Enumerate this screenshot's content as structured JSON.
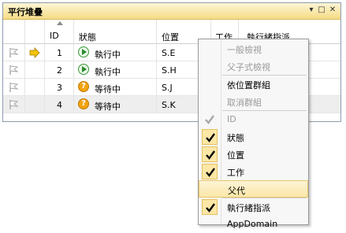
{
  "panel": {
    "title": "平行堆疊",
    "controls": {
      "dropdown": "▾",
      "maximize": "□",
      "close": "✕"
    }
  },
  "columns": [
    "",
    "",
    "ID",
    "狀態",
    "位置",
    "工作",
    "執行緒指派"
  ],
  "rows": [
    {
      "id": "1",
      "status": "執行中",
      "status_kind": "running",
      "location": "S.E",
      "current": true,
      "selected": false
    },
    {
      "id": "2",
      "status": "執行中",
      "status_kind": "running",
      "location": "S.H",
      "current": false,
      "selected": false
    },
    {
      "id": "3",
      "status": "等待中",
      "status_kind": "waiting",
      "location": "S.J",
      "current": false,
      "selected": false
    },
    {
      "id": "4",
      "status": "等待中",
      "status_kind": "waiting",
      "location": "S.K",
      "current": false,
      "selected": true
    }
  ],
  "status_icons": {
    "running": "play-icon",
    "waiting": "question-icon"
  },
  "context_menu": {
    "items": [
      {
        "label": "一般檢視",
        "enabled": false,
        "checked": false
      },
      {
        "label": "父子式檢視",
        "enabled": false,
        "checked": false
      },
      {
        "label": "依位置群組",
        "enabled": true,
        "checked": false
      },
      {
        "label": "取消群組",
        "enabled": false,
        "checked": false
      },
      {
        "label": "ID",
        "enabled": false,
        "checked": true
      },
      {
        "label": "狀態",
        "enabled": true,
        "checked": true
      },
      {
        "label": "位置",
        "enabled": true,
        "checked": true
      },
      {
        "label": "工作",
        "enabled": true,
        "checked": true
      },
      {
        "label": "父代",
        "enabled": true,
        "checked": false,
        "highlighted": true
      },
      {
        "label": "執行緒指派",
        "enabled": true,
        "checked": true
      },
      {
        "label": "AppDomain",
        "enabled": true,
        "checked": false
      }
    ]
  },
  "colors": {
    "title_gradient_top": "#fdf6d6",
    "title_gradient_bottom": "#f6dc86",
    "current_arrow": "#f5c400",
    "running": "#2d8a2d",
    "waiting": "#f2a30f"
  }
}
